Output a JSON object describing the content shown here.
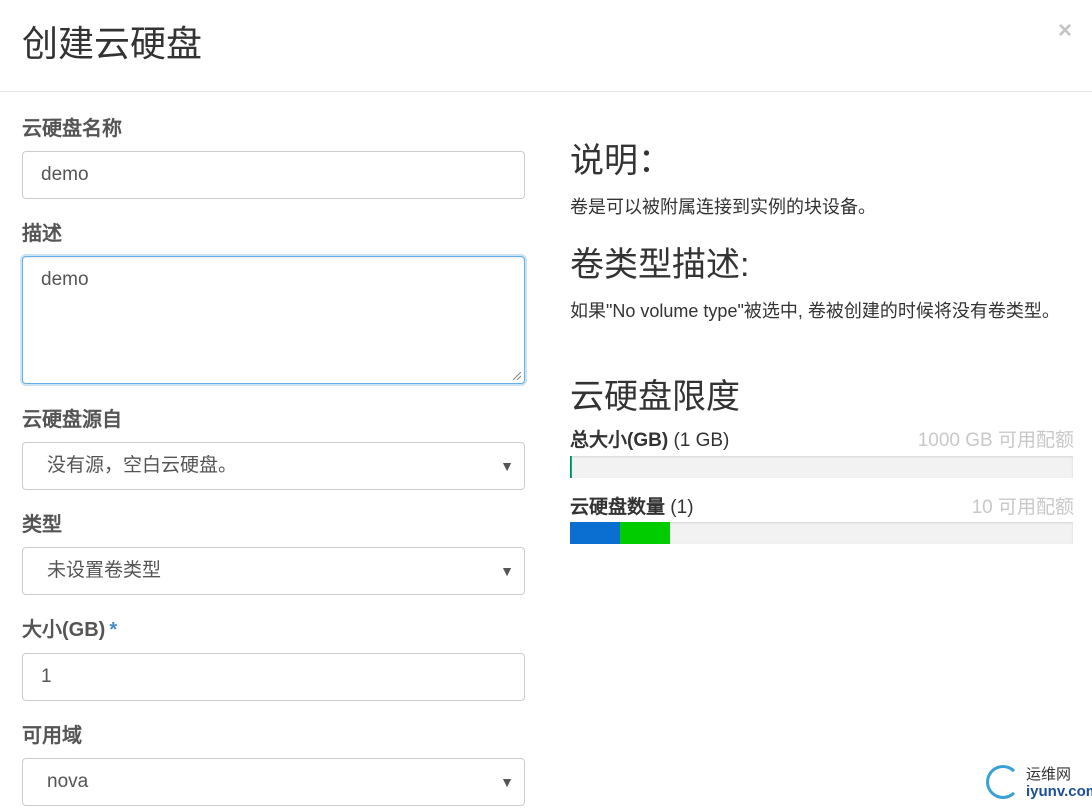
{
  "dialog": {
    "title": "创建云硬盘",
    "close": "×"
  },
  "form": {
    "name": {
      "label": "云硬盘名称",
      "value": "demo"
    },
    "description": {
      "label": "描述",
      "value": "demo"
    },
    "source": {
      "label": "云硬盘源自",
      "value": "没有源，空白云硬盘。"
    },
    "type": {
      "label": "类型",
      "value": "未设置卷类型"
    },
    "size": {
      "label": "大小(GB)",
      "required_mark": "*",
      "value": "1"
    },
    "az": {
      "label": "可用域",
      "value": "nova"
    }
  },
  "help": {
    "heading": "说明：",
    "text": "卷是可以被附属连接到实例的块设备。",
    "type_heading": "卷类型描述:",
    "type_text": "如果\"No volume type\"被选中, 卷被创建的时候将没有卷类型。",
    "limits_heading": "云硬盘限度"
  },
  "quotas": [
    {
      "name": "总大小(GB)",
      "used": "(1 GB)",
      "available": "1000 GB 可用配额",
      "used_fraction": 0.001,
      "added_fraction": 0.001
    },
    {
      "name": "云硬盘数量",
      "used": "(1)",
      "available": "10 可用配额",
      "used_fraction": 0.1,
      "added_fraction": 0.1
    }
  ],
  "colors": {
    "used": "#0a6fd0",
    "added": "#00cc00",
    "focus": "#66afe9"
  },
  "watermark": {
    "line1": "运维网",
    "line2": "iyunv.com"
  }
}
